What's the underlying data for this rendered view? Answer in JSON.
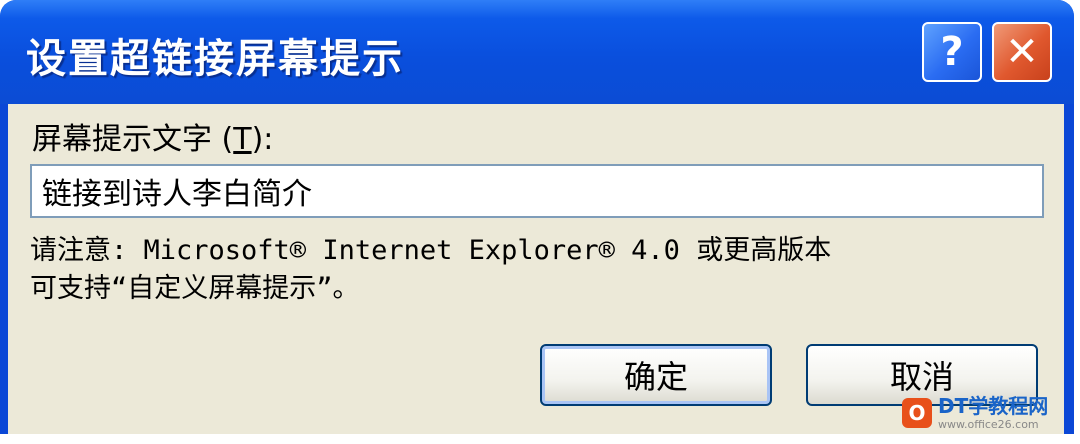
{
  "dialog": {
    "title": "设置超链接屏幕提示",
    "help_symbol": "?",
    "close_symbol": "✕",
    "field_label_prefix": "屏幕提示文字 (",
    "field_label_accel": "T",
    "field_label_suffix": "):",
    "field_value": "链接到诗人李白简介",
    "note_line1": "请注意: Microsoft® Internet Explorer® 4.0 或更高版本",
    "note_line2": "可支持“自定义屏幕提示”。",
    "ok_label": "确定",
    "cancel_label": "取消"
  },
  "watermark": {
    "logo_letter": "O",
    "main": "DT学教程网",
    "sub": "www.office26.com"
  },
  "colors": {
    "titlebar": "#0a4fdd",
    "client_bg": "#ece9d8",
    "close_button": "#e0582e",
    "help_button": "#2a6cf2",
    "input_border": "#7f9db9"
  },
  "icons": {
    "help": "help-icon",
    "close": "close-icon",
    "logo": "office-logo-icon"
  }
}
